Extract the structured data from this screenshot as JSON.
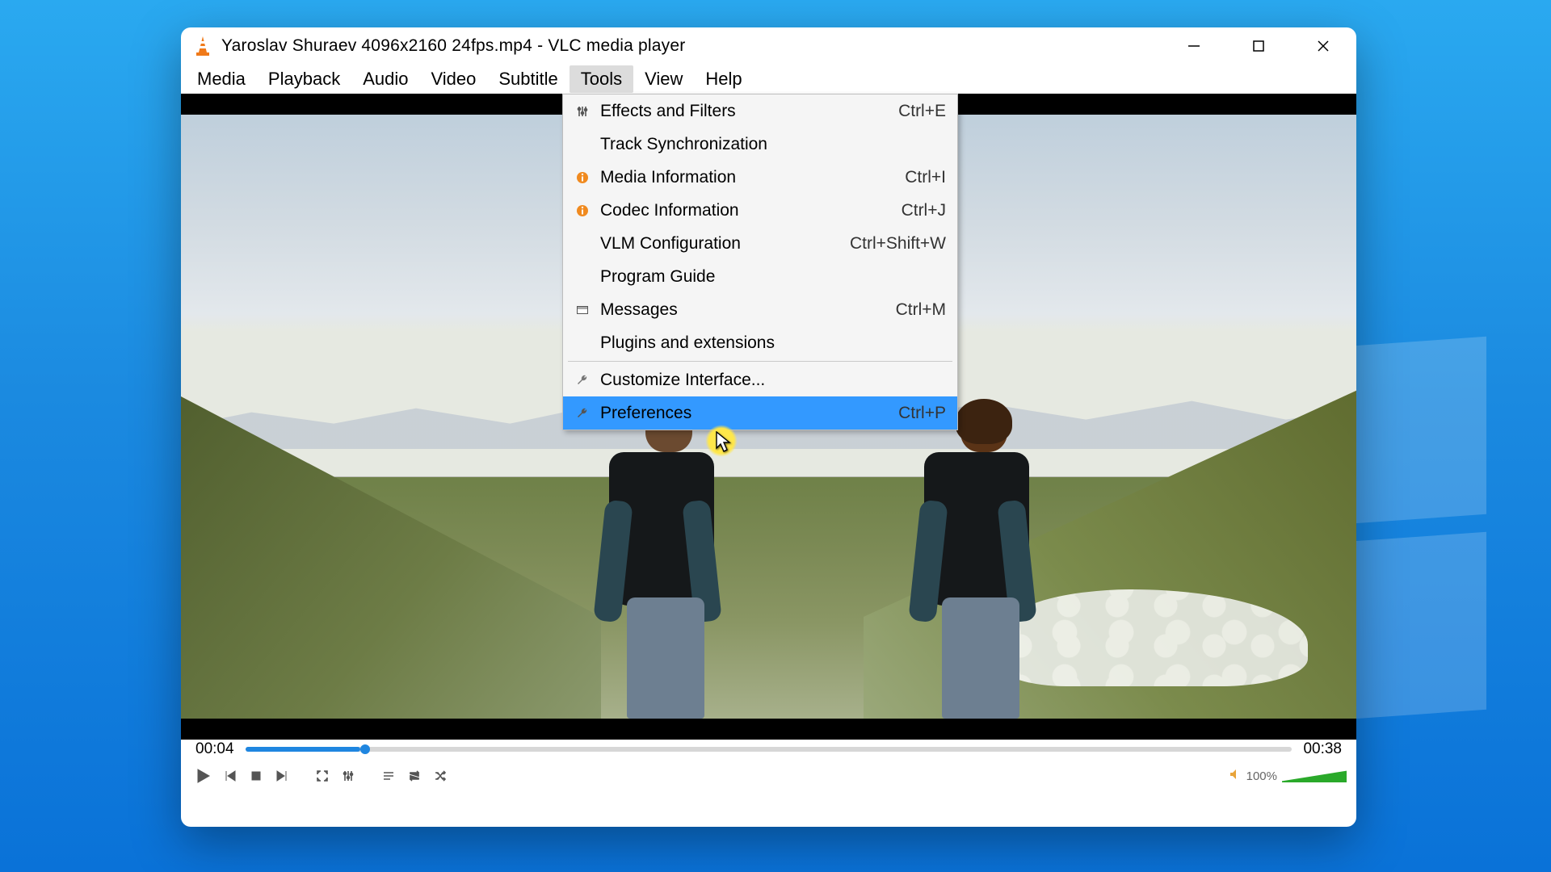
{
  "window": {
    "title": "Yaroslav Shuraev 4096x2160 24fps.mp4 - VLC media player"
  },
  "menubar": {
    "items": [
      "Media",
      "Playback",
      "Audio",
      "Video",
      "Subtitle",
      "Tools",
      "View",
      "Help"
    ],
    "open_index": 5
  },
  "tools_menu": {
    "items": [
      {
        "icon": "sliders",
        "label": "Effects and Filters",
        "shortcut": "Ctrl+E"
      },
      {
        "icon": "",
        "label": "Track Synchronization",
        "shortcut": ""
      },
      {
        "icon": "info",
        "label": "Media Information",
        "shortcut": "Ctrl+I"
      },
      {
        "icon": "info",
        "label": "Codec Information",
        "shortcut": "Ctrl+J"
      },
      {
        "icon": "",
        "label": "VLM Configuration",
        "shortcut": "Ctrl+Shift+W"
      },
      {
        "icon": "",
        "label": "Program Guide",
        "shortcut": ""
      },
      {
        "icon": "msg",
        "label": "Messages",
        "shortcut": "Ctrl+M"
      },
      {
        "icon": "",
        "label": "Plugins and extensions",
        "shortcut": ""
      }
    ],
    "items2": [
      {
        "icon": "wrench",
        "label": "Customize Interface...",
        "shortcut": ""
      },
      {
        "icon": "wrench",
        "label": "Preferences",
        "shortcut": "Ctrl+P",
        "hov": true
      }
    ]
  },
  "playback": {
    "elapsed": "00:04",
    "total": "00:38",
    "volume_label": "100%"
  },
  "icons": {
    "info_color": "#f08a1f"
  }
}
